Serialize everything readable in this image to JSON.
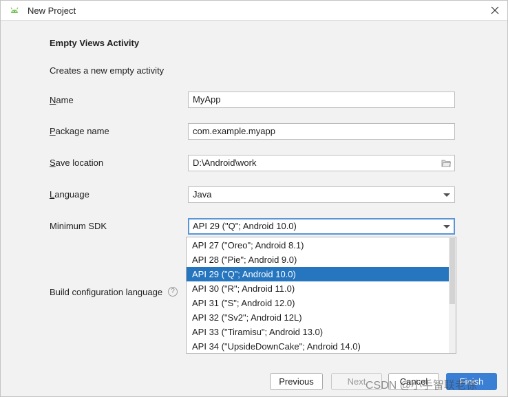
{
  "window": {
    "title": "New Project",
    "app_icon": "android-icon",
    "close_icon": "close-icon"
  },
  "content": {
    "section_title": "Empty Views Activity",
    "description": "Creates a new empty activity"
  },
  "form": {
    "name": {
      "label_first": "N",
      "label_rest": "ame",
      "value": "MyApp"
    },
    "package": {
      "label_first": "P",
      "label_rest": "ackage name",
      "value": "com.example.myapp"
    },
    "save_location": {
      "label_first": "S",
      "label_rest": "ave location",
      "value": "D:\\Android\\work",
      "icon": "folder-icon"
    },
    "language": {
      "label_first": "L",
      "label_rest": "anguage",
      "value": "Java"
    },
    "min_sdk": {
      "label": "Minimum SDK",
      "value": "API 29 (\"Q\"; Android 10.0)"
    },
    "build_config": {
      "label": "Build configuration language",
      "help_icon": "?"
    }
  },
  "sdk_options": [
    "API 27 (\"Oreo\"; Android 8.1)",
    "API 28 (\"Pie\"; Android 9.0)",
    "API 29 (\"Q\"; Android 10.0)",
    "API 30 (\"R\"; Android 11.0)",
    "API 31 (\"S\"; Android 12.0)",
    "API 32 (\"Sv2\"; Android 12L)",
    "API 33 (\"Tiramisu\"; Android 13.0)",
    "API 34 (\"UpsideDownCake\"; Android 14.0)"
  ],
  "sdk_selected_index": 2,
  "buttons": {
    "previous": "Previous",
    "next": "Next",
    "cancel": "Cancel",
    "finish": "Finish"
  },
  "watermark": "CSDN @小手智联老徐",
  "colors": {
    "selection": "#2675bf",
    "focus_border": "#5a95d8",
    "primary_button": "#3b7fd4"
  }
}
